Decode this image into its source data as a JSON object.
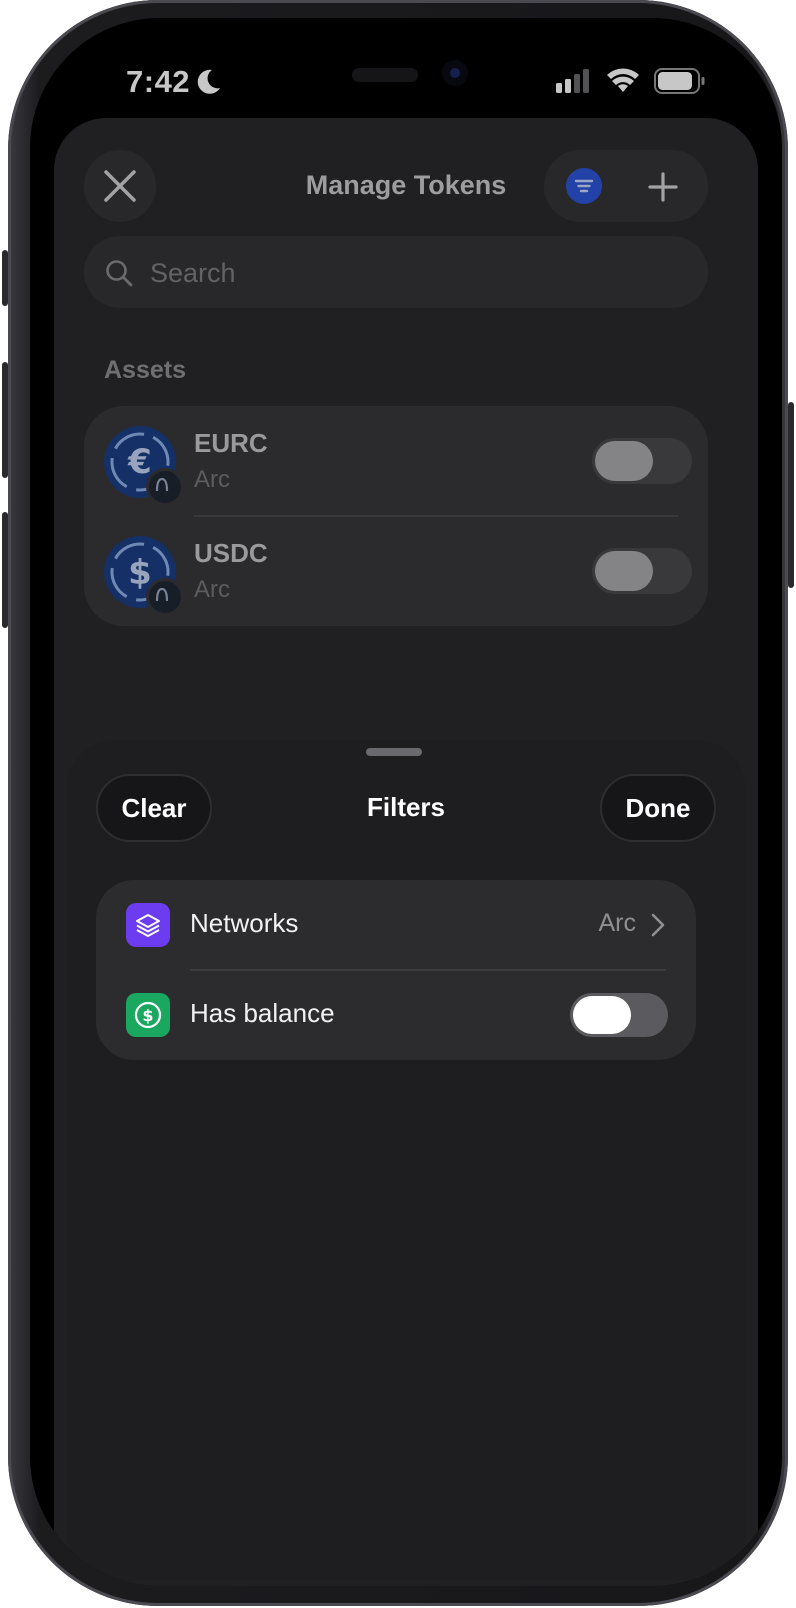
{
  "status_bar": {
    "time": "7:42"
  },
  "manage_tokens": {
    "title": "Manage Tokens",
    "search_placeholder": "Search",
    "assets_label": "Assets",
    "assets": [
      {
        "symbol": "EURC",
        "network": "Arc",
        "currency_glyph": "€",
        "enabled": false
      },
      {
        "symbol": "USDC",
        "network": "Arc",
        "currency_glyph": "$",
        "enabled": false
      }
    ]
  },
  "filters_sheet": {
    "title": "Filters",
    "clear_label": "Clear",
    "done_label": "Done",
    "networks_label": "Networks",
    "networks_value": "Arc",
    "has_balance_label": "Has balance",
    "has_balance_enabled": false
  },
  "colors": {
    "networks_icon": "#6b3cf0",
    "balance_icon": "#1aa760",
    "filter_active": "#2e55d8",
    "token_blue": "#1a3e84"
  }
}
